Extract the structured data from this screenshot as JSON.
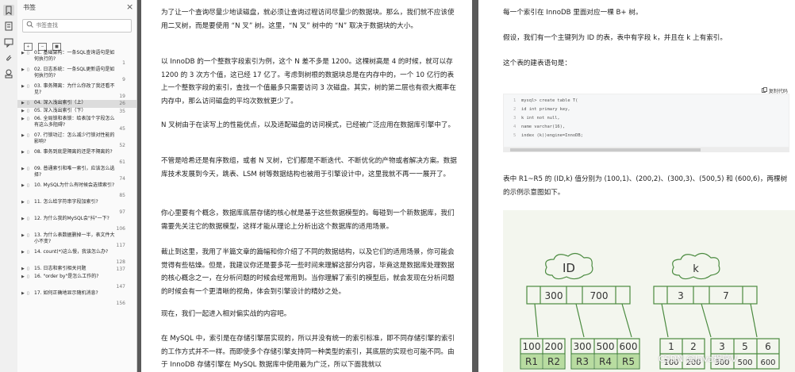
{
  "rail": {
    "icons": [
      "bookmark-icon",
      "thumbnail-icon",
      "annotation-icon",
      "attachment-icon",
      "stamp-icon"
    ]
  },
  "panel": {
    "title": "书签",
    "close_glyph": "×",
    "search_placeholder": "书签查找",
    "items": [
      {
        "text": "01. 基础架构：一条SQL查询语句是如何执行的?",
        "page": "1",
        "active": false
      },
      {
        "text": "02. 日志系统：一条SQL更新语句是如何执行的?",
        "page": "9",
        "active": false
      },
      {
        "text": "03. 事务隔离：为什么你改了我还看不见?",
        "page": "19",
        "active": false
      },
      {
        "text": "04. 深入浅出索引（上）",
        "page": "26",
        "active": true
      },
      {
        "text": "05. 深入浅出索引（下）",
        "page": "35",
        "active": false
      },
      {
        "text": "06. 全局锁和表锁：给表加个字段怎么有这么多阻碍?",
        "page": "45",
        "active": false
      },
      {
        "text": "07. 行锁功过：怎么减少行锁对性能的影响?",
        "page": "52",
        "active": false
      },
      {
        "text": "08. 事务到底是隔离的还是不隔离的?",
        "page": "61",
        "active": false
      },
      {
        "text": "09. 普通索引和唯一索引，应该怎么选择?",
        "page": "74",
        "active": false
      },
      {
        "text": "10. MySQL为什么有时候会选错索引?",
        "page": "85",
        "active": false
      },
      {
        "text": "11. 怎么给字符串字段加索引?",
        "page": "97",
        "active": false
      },
      {
        "text": "12. 为什么我的MySQL会\"抖\"一下?",
        "page": "106",
        "active": false
      },
      {
        "text": "13. 为什么表数据删掉一半，表文件大小不变?",
        "page": "117",
        "active": false
      },
      {
        "text": "14. count(*)这么慢，我该怎么办?",
        "page": "128",
        "active": false
      },
      {
        "text": "15. 日志和索引相关问题",
        "page": "137",
        "active": false
      },
      {
        "text": "16. \"order by\"是怎么工作的?",
        "page": "147",
        "active": false
      },
      {
        "text": "17. 如何正确地显示随机消息?",
        "page": "156",
        "active": false
      }
    ]
  },
  "left_page": {
    "paragraphs": [
      "为了让一个查询尽量少地读磁盘，就必须让查询过程访问尽量少的数据块。那么，我们就不应该使用二叉树，而是要使用 “N 叉” 树。这里，“N 叉” 树中的 “N” 取决于数据块的大小。",
      "以 InnoDB 的一个整数字段索引为例，这个 N 差不多是 1200。这棵树高是 4 的时候，就可以存 1200 的 3 次方个值，这已经 17 亿了。考虑到树根的数据块总是在内存中的，一个 10 亿行的表上一个整数字段的索引，查找一个值最多只需要访问 3 次磁盘。其实，树的第二层也有很大概率在内存中，那么访问磁盘的平均次数就更少了。",
      "N 叉树由于在读写上的性能优点，以及适配磁盘的访问模式，已经被广泛应用在数据库引擎中了。",
      "不管是哈希还是有序数组，或者 N 叉树，它们都是不断迭代、不断优化的产物或者解决方案。数据库技术发展到今天，跳表、LSM 树等数据结构也被用于引擎设计中，这里我就不再一一展开了。",
      "你心里要有个概念，数据库底层存储的核心就是基于这些数据模型的。每碰到一个新数据库，我们需要先关注它的数据模型，这样才能从理论上分析出这个数据库的适用场景。",
      "截止到这里，我用了半篇文章的篇幅和你介绍了不同的数据结构，以及它们的适用场景，你可能会觉得有些枯燥。但是，我建议你还是要多花一些时间来理解这部分内容，毕竟这是数据库处理数据的核心概念之一，在分析问题的时候会经常用到。当你理解了索引的模型后，就会发现在分析问题的时候会有一个更清晰的视角，体会到引擎设计的精妙之处。",
      "现在，我们一起进入相对偏实战的内容吧。",
      "在 MySQL 中，索引是在存储引擎层实现的，所以并没有统一的索引标准，即不同存储引擎的索引的工作方式并不一样。而即使多个存储引擎支持同一种类型的索引，其底层的实现也可能不同。由于 InnoDB 存储引擎在 MySQL 数据库中使用最为广泛，所以下面我就以"
    ]
  },
  "right_page": {
    "p1": "每一个索引在 InnoDB 里面对应一棵 B+ 树。",
    "p2": "假设，我们有一个主键列为 ID 的表，表中有字段 k，并且在 k 上有索引。",
    "p3": "这个表的建表语句是：",
    "copy_label": "复制代码",
    "code_lines": [
      {
        "n": "1",
        "text": "mysql> create table T("
      },
      {
        "n": "2",
        "text": "id int primary key,"
      },
      {
        "n": "3",
        "text": "k int not null,"
      },
      {
        "n": "4",
        "text": "name varchar(16),"
      },
      {
        "n": "5",
        "text": "index (k))engine=InnoDB;"
      }
    ],
    "p4": "表中 R1~R5 的 (ID,k) 值分别为 (100,1)、(200,2)、(300,3)、(500,5) 和 (600,6)，两棵树的示例示意图如下。",
    "diagram": {
      "id_label": "ID",
      "k_label": "k",
      "id_root": [
        "300",
        "700"
      ],
      "k_root": [
        "3",
        "7"
      ],
      "id_leaves": [
        "100",
        "200",
        "300",
        "500",
        "600"
      ],
      "id_rows": [
        "R1",
        "R2",
        "R3",
        "R4",
        "R5"
      ],
      "k_leaves": [
        "1",
        "2",
        "3",
        "5",
        "6"
      ],
      "k_rows": [
        "100",
        "200",
        "300",
        "500",
        "600"
      ]
    },
    "watermark": "CSDN @Java程序V"
  }
}
